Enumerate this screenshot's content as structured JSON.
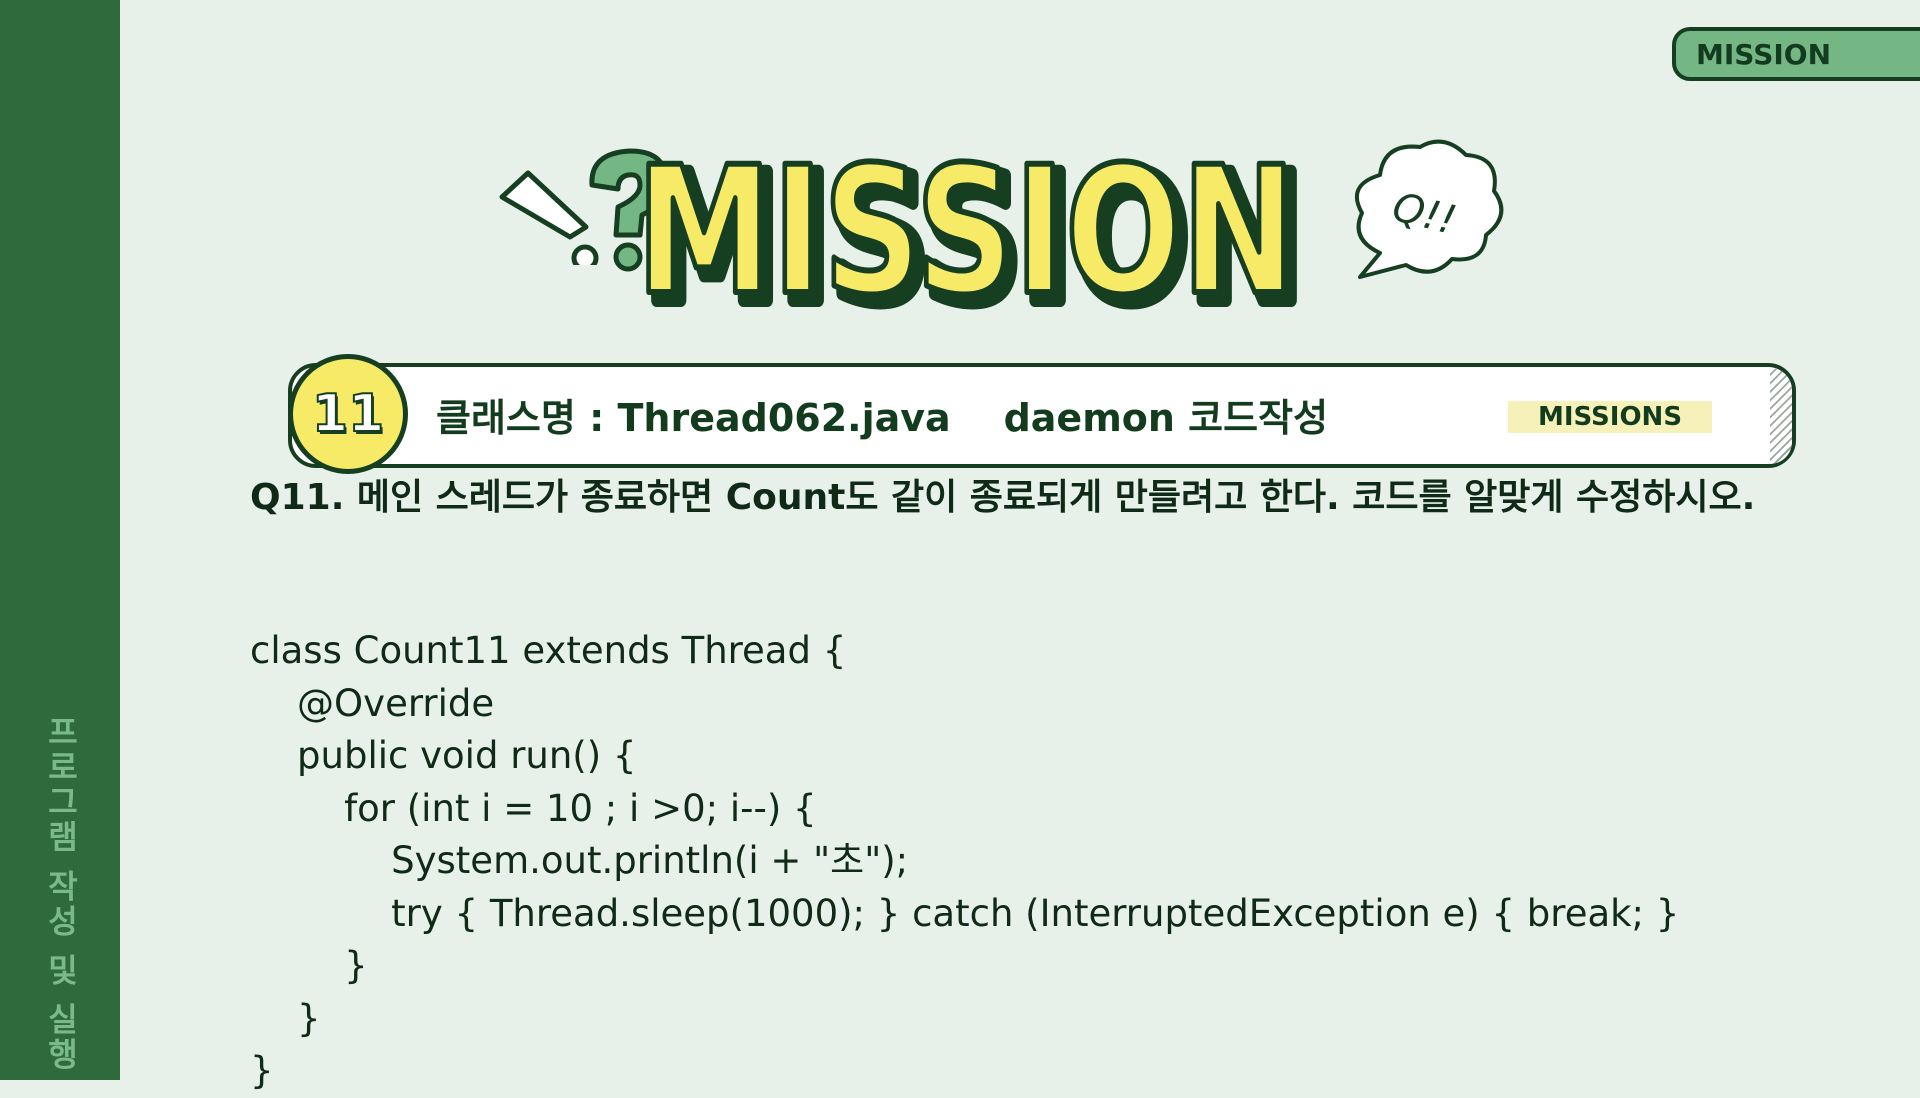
{
  "sidebar": {
    "label": "프로그램 작성 및 실행"
  },
  "corner_tag": {
    "label": "MISSION"
  },
  "logo": {
    "text": "MISSION",
    "bubble_text": "Q!!"
  },
  "mission_header": {
    "number": "11",
    "title": "클래스명 : Thread062.java    daemon 코드작성",
    "tag": "MISSIONS"
  },
  "question": "Q11. 메인 스레드가 종료하면 Count도 같이 종료되게 만들려고 한다. 코드를 알맞게 수정하시오.",
  "code_lines": [
    "class Count11 extends Thread {",
    "    @Override",
    "    public void run() {",
    "        for (int i = 10 ; i >0; i--) {",
    "            System.out.println(i + \"초\");",
    "            try { Thread.sleep(1000); } catch (InterruptedException e) { break; }",
    "        }",
    "    }",
    "}"
  ],
  "colors": {
    "background": "#e8f0ea",
    "sidebar": "#2f6a3a",
    "accent_green": "#74b785",
    "logo_yellow": "#f6ea67",
    "dark_green": "#163f22"
  }
}
